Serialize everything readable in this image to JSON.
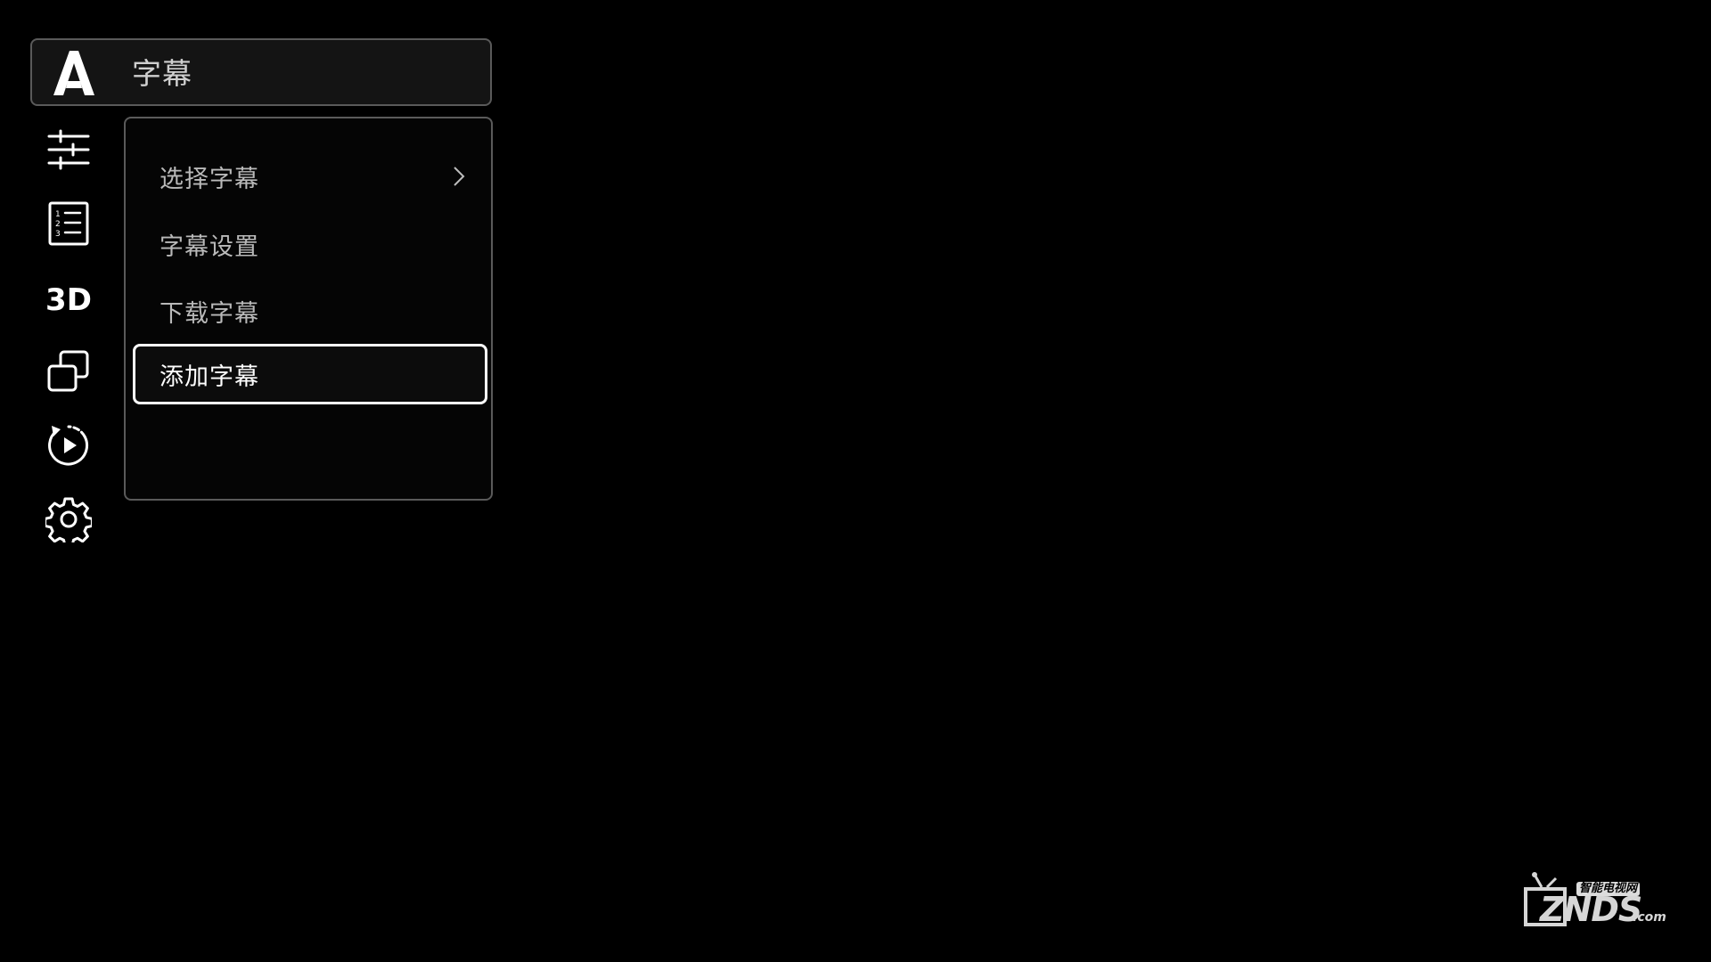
{
  "header": {
    "title": "字幕",
    "icon": "subtitle-a-icon"
  },
  "sidebar": {
    "items": [
      {
        "name": "picture-adjust",
        "icon": "sliders-icon"
      },
      {
        "name": "playlist",
        "icon": "numbered-list-icon"
      },
      {
        "name": "3d",
        "icon": "3d-icon",
        "label": "3D"
      },
      {
        "name": "window-mode",
        "icon": "overlap-windows-icon"
      },
      {
        "name": "playback-mode",
        "icon": "replay-icon"
      },
      {
        "name": "settings",
        "icon": "gear-icon"
      }
    ]
  },
  "menu": {
    "items": [
      {
        "label": "选择字幕",
        "has_submenu": true
      },
      {
        "label": "字幕设置",
        "has_submenu": false
      },
      {
        "label": "下载字幕",
        "has_submenu": false
      },
      {
        "label": "添加字幕",
        "has_submenu": false,
        "selected": true
      }
    ]
  },
  "watermark": {
    "tagline": "智能电视网",
    "brand": "ZNDS",
    "domain": ".com"
  },
  "colors": {
    "background": "#000000",
    "border": "#5a5a5a",
    "text": "#b9b9b9",
    "selected_border": "#ffffff"
  }
}
